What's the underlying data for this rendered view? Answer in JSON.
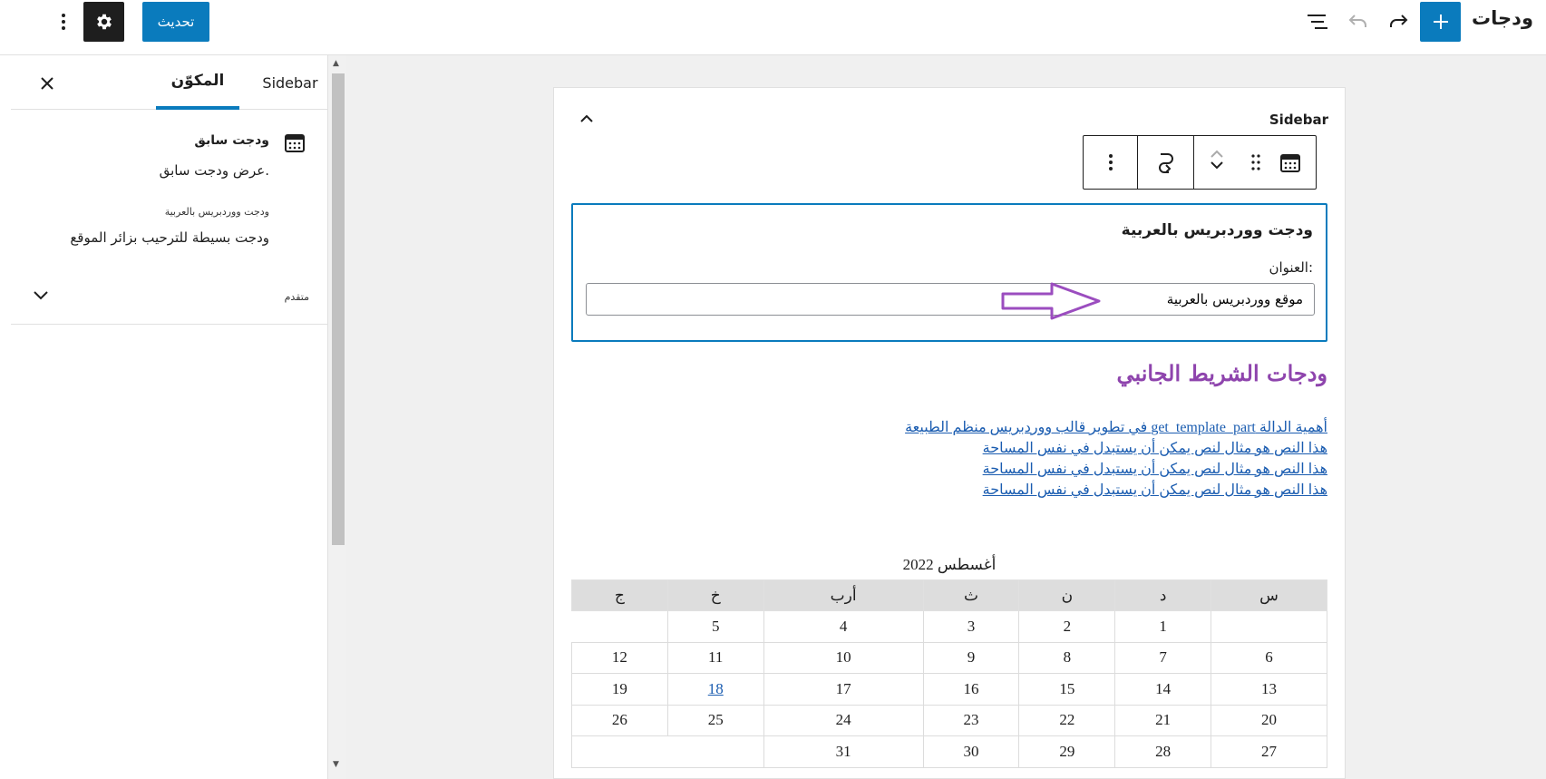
{
  "header": {
    "title": "ودجات",
    "update_label": "تحديث"
  },
  "sidebar": {
    "tabs": [
      {
        "label": "Sidebar",
        "active": false
      },
      {
        "label": "المكوّن",
        "active": true
      }
    ],
    "block_card": {
      "title": "ودجت سابق",
      "description": "عرض ودجت سابق.",
      "widget_name": "ودجت ووردبريس بالعربية",
      "widget_description": "ودجت بسيطة للترحيب بزائر الموقع"
    },
    "advanced_label": "متقدم"
  },
  "canvas": {
    "area_title": "Sidebar",
    "legacy_widget": {
      "title": "ودجت ووردبريس بالعربية",
      "field_label": "العنوان:",
      "field_value": "موقع ووردبريس بالعربية"
    },
    "rendered": {
      "title": "ودجات الشريط الجانبي",
      "posts": [
        "أهمية الدالة get_template_part في تطوير قالب ووردبريس منظم الطبيعة",
        "هذا النص هو مثال لنص يمكن أن يستبدل في نفس المساحة",
        "هذا النص هو مثال لنص يمكن أن يستبدل في نفس المساحة",
        "هذا النص هو مثال لنص يمكن أن يستبدل في نفس المساحة"
      ]
    },
    "calendar": {
      "caption": "أغسطس 2022",
      "weekdays": [
        "س",
        "د",
        "ن",
        "ث",
        "أرب",
        "خ",
        "ج"
      ],
      "weeks": [
        [
          "",
          "1",
          "2",
          "3",
          "4",
          "5"
        ],
        [
          "6",
          "7",
          "8",
          "9",
          "10",
          "11",
          "12"
        ],
        [
          "13",
          "14",
          "15",
          "16",
          "17",
          "18",
          "19"
        ],
        [
          "20",
          "21",
          "22",
          "23",
          "24",
          "25",
          "26"
        ],
        [
          "27",
          "28",
          "29",
          "30",
          "31"
        ]
      ],
      "linked_day": "18"
    }
  },
  "colors": {
    "accent": "#0a7bbd",
    "heading_purple": "#8e44ad",
    "link": "#1a5cb0",
    "arrow_annotation": "#9b4dbf"
  }
}
